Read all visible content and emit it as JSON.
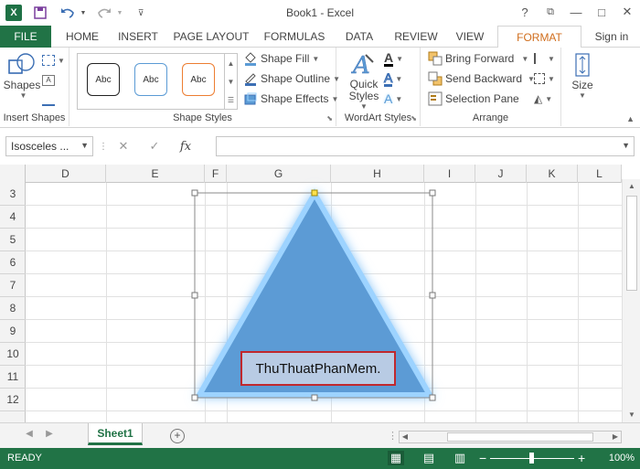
{
  "window": {
    "title": "Book1 - Excel",
    "controls": {
      "help": "?",
      "restore": "⧉",
      "minimize": "—",
      "maximize": "□",
      "close": "✕"
    }
  },
  "qat": {
    "save_icon": "save-icon",
    "undo_icon": "undo-icon",
    "redo_icon": "redo-icon"
  },
  "tabs": [
    "FILE",
    "HOME",
    "INSERT",
    "PAGE LAYOUT",
    "FORMULAS",
    "DATA",
    "REVIEW",
    "VIEW",
    "FORMAT"
  ],
  "sign_in": "Sign in",
  "ribbon": {
    "insert_shapes": {
      "shapes_label": "Shapes",
      "group_label": "Insert Shapes"
    },
    "shape_styles": {
      "gallery": [
        "Abc",
        "Abc",
        "Abc"
      ],
      "fill": "Shape Fill",
      "outline": "Shape Outline",
      "effects": "Shape Effects",
      "group_label": "Shape Styles"
    },
    "wordart": {
      "quick_styles_line1": "Quick",
      "quick_styles_line2": "Styles",
      "group_label": "WordArt Styles"
    },
    "arrange": {
      "bring_forward": "Bring Forward",
      "send_backward": "Send Backward",
      "selection_pane": "Selection Pane",
      "group_label": "Arrange"
    },
    "size": {
      "label": "Size"
    }
  },
  "formula_bar": {
    "name_box": "Isosceles ...",
    "cancel": "✕",
    "enter": "✓",
    "fx": "fx",
    "formula": ""
  },
  "columns": [
    "D",
    "E",
    "F",
    "G",
    "H",
    "I",
    "J",
    "K",
    "L"
  ],
  "rows": [
    "3",
    "4",
    "5",
    "6",
    "7",
    "8",
    "9",
    "10",
    "11",
    "12"
  ],
  "shape": {
    "text": "ThuThuatPhanMem.",
    "fill": "#5b9bd5",
    "glow": "#9dd3ff"
  },
  "sheets": {
    "active": "Sheet1",
    "add": "+"
  },
  "status": {
    "text": "READY",
    "zoom": "100%",
    "minus": "−",
    "plus": "+"
  },
  "colors": {
    "accent": "#217346",
    "format_tab": "#d06d1c"
  }
}
